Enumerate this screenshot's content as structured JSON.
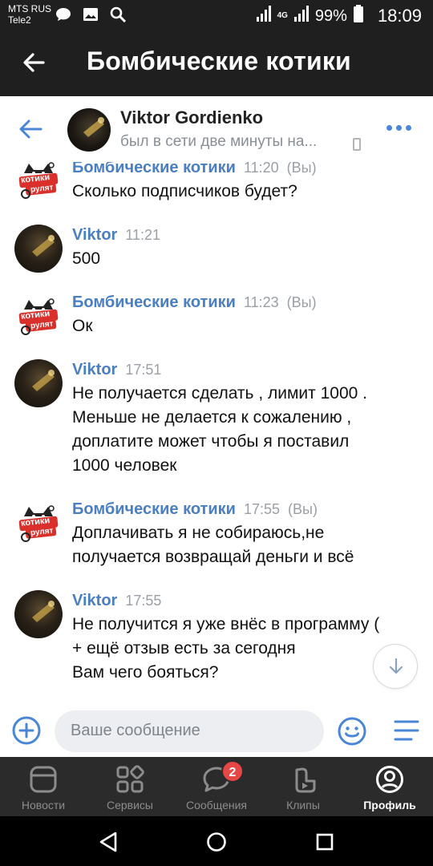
{
  "status_bar": {
    "carrier_1": "MTS RUS",
    "carrier_2": "Tele2",
    "network": "4G",
    "battery": "99%",
    "time": "18:09"
  },
  "app_bar": {
    "title": "Бомбические котики"
  },
  "chat_header": {
    "name": "Viktor Gordienko",
    "status": "был в сети две минуты на..."
  },
  "messages": [
    {
      "author": "Бомбические котики",
      "time": "11:20",
      "you": "(Вы)",
      "avatar": "cat-logo",
      "lines": [
        "Сколько подписчиков будет?"
      ]
    },
    {
      "author": "Viktor",
      "time": "11:21",
      "you": "",
      "avatar": "viktor-photo",
      "lines": [
        "500"
      ]
    },
    {
      "author": "Бомбические котики",
      "time": "11:23",
      "you": "(Вы)",
      "avatar": "cat-logo",
      "lines": [
        "Ок"
      ]
    },
    {
      "author": "Viktor",
      "time": "17:51",
      "you": "",
      "avatar": "viktor-photo",
      "lines": [
        "Не получается сделать , лимит 1000 .",
        "Меньше не делается к сожалению ,",
        "доплатите может чтобы я поставил",
        "1000 человек"
      ]
    },
    {
      "author": "Бомбические котики",
      "time": "17:55",
      "you": "(Вы)",
      "avatar": "cat-logo",
      "lines": [
        "Доплачивать я не собираюсь,не",
        "получается возвращай деньги и всё"
      ]
    },
    {
      "author": "Viktor",
      "time": "17:55",
      "you": "",
      "avatar": "viktor-photo",
      "lines": [
        "Не получится я уже внёс в программу (",
        "+ ещё отзыв есть за сегодня",
        "Вам чего бояться?"
      ]
    }
  ],
  "composer": {
    "placeholder": "Ваше сообщение"
  },
  "tabs": [
    {
      "label": "Новости",
      "icon": "news-icon"
    },
    {
      "label": "Сервисы",
      "icon": "services-icon"
    },
    {
      "label": "Сообщения",
      "icon": "messages-icon",
      "badge": "2"
    },
    {
      "label": "Клипы",
      "icon": "clips-icon"
    },
    {
      "label": "Профиль",
      "icon": "profile-icon",
      "active": true
    }
  ],
  "cat_logo_text": [
    "котики",
    "рулят"
  ],
  "colors": {
    "accent": "#4a86d6",
    "author": "#4a7fc1",
    "badge": "#e64646",
    "dark_bar": "#1f1f1f",
    "tab_bar": "#2b2b2b"
  }
}
